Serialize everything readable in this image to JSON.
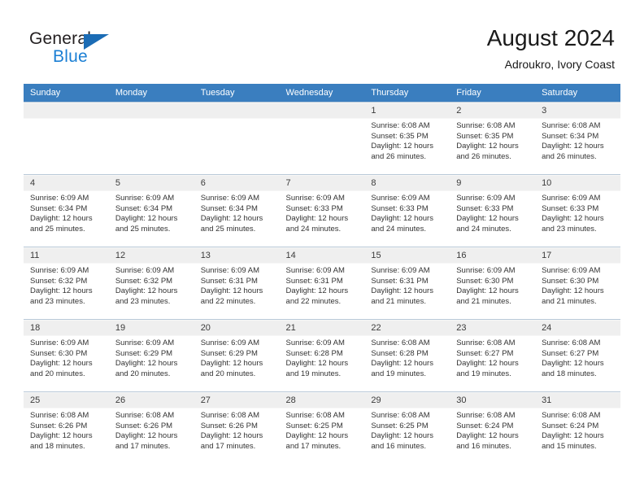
{
  "logo": {
    "word_one": "General",
    "word_two": "Blue",
    "triangle_color": "#1b6cb5",
    "blue_color": "#1b7fd4"
  },
  "header": {
    "title": "August 2024",
    "subtitle": "Adroukro, Ivory Coast",
    "header_bg": "#3a7ebf"
  },
  "weekdays": [
    "Sunday",
    "Monday",
    "Tuesday",
    "Wednesday",
    "Thursday",
    "Friday",
    "Saturday"
  ],
  "weeks": [
    [
      {
        "day": "",
        "sunrise": "",
        "sunset": "",
        "daylight1": "",
        "daylight2": ""
      },
      {
        "day": "",
        "sunrise": "",
        "sunset": "",
        "daylight1": "",
        "daylight2": ""
      },
      {
        "day": "",
        "sunrise": "",
        "sunset": "",
        "daylight1": "",
        "daylight2": ""
      },
      {
        "day": "",
        "sunrise": "",
        "sunset": "",
        "daylight1": "",
        "daylight2": ""
      },
      {
        "day": "1",
        "sunrise": "Sunrise: 6:08 AM",
        "sunset": "Sunset: 6:35 PM",
        "daylight1": "Daylight: 12 hours",
        "daylight2": "and 26 minutes."
      },
      {
        "day": "2",
        "sunrise": "Sunrise: 6:08 AM",
        "sunset": "Sunset: 6:35 PM",
        "daylight1": "Daylight: 12 hours",
        "daylight2": "and 26 minutes."
      },
      {
        "day": "3",
        "sunrise": "Sunrise: 6:08 AM",
        "sunset": "Sunset: 6:34 PM",
        "daylight1": "Daylight: 12 hours",
        "daylight2": "and 26 minutes."
      }
    ],
    [
      {
        "day": "4",
        "sunrise": "Sunrise: 6:09 AM",
        "sunset": "Sunset: 6:34 PM",
        "daylight1": "Daylight: 12 hours",
        "daylight2": "and 25 minutes."
      },
      {
        "day": "5",
        "sunrise": "Sunrise: 6:09 AM",
        "sunset": "Sunset: 6:34 PM",
        "daylight1": "Daylight: 12 hours",
        "daylight2": "and 25 minutes."
      },
      {
        "day": "6",
        "sunrise": "Sunrise: 6:09 AM",
        "sunset": "Sunset: 6:34 PM",
        "daylight1": "Daylight: 12 hours",
        "daylight2": "and 25 minutes."
      },
      {
        "day": "7",
        "sunrise": "Sunrise: 6:09 AM",
        "sunset": "Sunset: 6:33 PM",
        "daylight1": "Daylight: 12 hours",
        "daylight2": "and 24 minutes."
      },
      {
        "day": "8",
        "sunrise": "Sunrise: 6:09 AM",
        "sunset": "Sunset: 6:33 PM",
        "daylight1": "Daylight: 12 hours",
        "daylight2": "and 24 minutes."
      },
      {
        "day": "9",
        "sunrise": "Sunrise: 6:09 AM",
        "sunset": "Sunset: 6:33 PM",
        "daylight1": "Daylight: 12 hours",
        "daylight2": "and 24 minutes."
      },
      {
        "day": "10",
        "sunrise": "Sunrise: 6:09 AM",
        "sunset": "Sunset: 6:33 PM",
        "daylight1": "Daylight: 12 hours",
        "daylight2": "and 23 minutes."
      }
    ],
    [
      {
        "day": "11",
        "sunrise": "Sunrise: 6:09 AM",
        "sunset": "Sunset: 6:32 PM",
        "daylight1": "Daylight: 12 hours",
        "daylight2": "and 23 minutes."
      },
      {
        "day": "12",
        "sunrise": "Sunrise: 6:09 AM",
        "sunset": "Sunset: 6:32 PM",
        "daylight1": "Daylight: 12 hours",
        "daylight2": "and 23 minutes."
      },
      {
        "day": "13",
        "sunrise": "Sunrise: 6:09 AM",
        "sunset": "Sunset: 6:31 PM",
        "daylight1": "Daylight: 12 hours",
        "daylight2": "and 22 minutes."
      },
      {
        "day": "14",
        "sunrise": "Sunrise: 6:09 AM",
        "sunset": "Sunset: 6:31 PM",
        "daylight1": "Daylight: 12 hours",
        "daylight2": "and 22 minutes."
      },
      {
        "day": "15",
        "sunrise": "Sunrise: 6:09 AM",
        "sunset": "Sunset: 6:31 PM",
        "daylight1": "Daylight: 12 hours",
        "daylight2": "and 21 minutes."
      },
      {
        "day": "16",
        "sunrise": "Sunrise: 6:09 AM",
        "sunset": "Sunset: 6:30 PM",
        "daylight1": "Daylight: 12 hours",
        "daylight2": "and 21 minutes."
      },
      {
        "day": "17",
        "sunrise": "Sunrise: 6:09 AM",
        "sunset": "Sunset: 6:30 PM",
        "daylight1": "Daylight: 12 hours",
        "daylight2": "and 21 minutes."
      }
    ],
    [
      {
        "day": "18",
        "sunrise": "Sunrise: 6:09 AM",
        "sunset": "Sunset: 6:30 PM",
        "daylight1": "Daylight: 12 hours",
        "daylight2": "and 20 minutes."
      },
      {
        "day": "19",
        "sunrise": "Sunrise: 6:09 AM",
        "sunset": "Sunset: 6:29 PM",
        "daylight1": "Daylight: 12 hours",
        "daylight2": "and 20 minutes."
      },
      {
        "day": "20",
        "sunrise": "Sunrise: 6:09 AM",
        "sunset": "Sunset: 6:29 PM",
        "daylight1": "Daylight: 12 hours",
        "daylight2": "and 20 minutes."
      },
      {
        "day": "21",
        "sunrise": "Sunrise: 6:09 AM",
        "sunset": "Sunset: 6:28 PM",
        "daylight1": "Daylight: 12 hours",
        "daylight2": "and 19 minutes."
      },
      {
        "day": "22",
        "sunrise": "Sunrise: 6:08 AM",
        "sunset": "Sunset: 6:28 PM",
        "daylight1": "Daylight: 12 hours",
        "daylight2": "and 19 minutes."
      },
      {
        "day": "23",
        "sunrise": "Sunrise: 6:08 AM",
        "sunset": "Sunset: 6:27 PM",
        "daylight1": "Daylight: 12 hours",
        "daylight2": "and 19 minutes."
      },
      {
        "day": "24",
        "sunrise": "Sunrise: 6:08 AM",
        "sunset": "Sunset: 6:27 PM",
        "daylight1": "Daylight: 12 hours",
        "daylight2": "and 18 minutes."
      }
    ],
    [
      {
        "day": "25",
        "sunrise": "Sunrise: 6:08 AM",
        "sunset": "Sunset: 6:26 PM",
        "daylight1": "Daylight: 12 hours",
        "daylight2": "and 18 minutes."
      },
      {
        "day": "26",
        "sunrise": "Sunrise: 6:08 AM",
        "sunset": "Sunset: 6:26 PM",
        "daylight1": "Daylight: 12 hours",
        "daylight2": "and 17 minutes."
      },
      {
        "day": "27",
        "sunrise": "Sunrise: 6:08 AM",
        "sunset": "Sunset: 6:26 PM",
        "daylight1": "Daylight: 12 hours",
        "daylight2": "and 17 minutes."
      },
      {
        "day": "28",
        "sunrise": "Sunrise: 6:08 AM",
        "sunset": "Sunset: 6:25 PM",
        "daylight1": "Daylight: 12 hours",
        "daylight2": "and 17 minutes."
      },
      {
        "day": "29",
        "sunrise": "Sunrise: 6:08 AM",
        "sunset": "Sunset: 6:25 PM",
        "daylight1": "Daylight: 12 hours",
        "daylight2": "and 16 minutes."
      },
      {
        "day": "30",
        "sunrise": "Sunrise: 6:08 AM",
        "sunset": "Sunset: 6:24 PM",
        "daylight1": "Daylight: 12 hours",
        "daylight2": "and 16 minutes."
      },
      {
        "day": "31",
        "sunrise": "Sunrise: 6:08 AM",
        "sunset": "Sunset: 6:24 PM",
        "daylight1": "Daylight: 12 hours",
        "daylight2": "and 15 minutes."
      }
    ]
  ]
}
